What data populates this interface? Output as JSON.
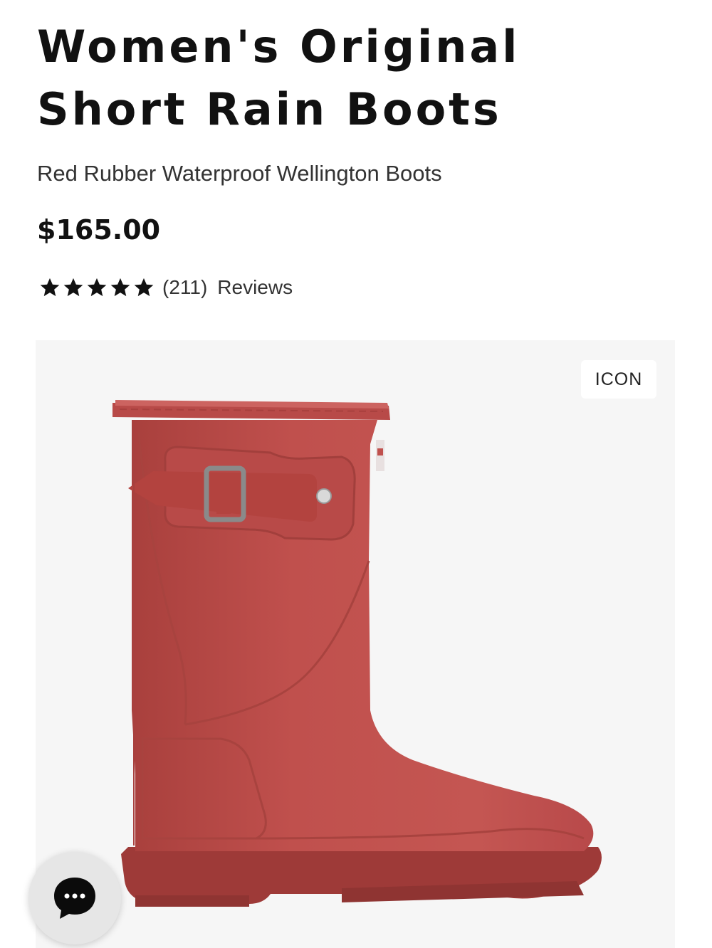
{
  "product": {
    "title": "Women's Original Short Rain Boots",
    "subtitle": "Red Rubber Waterproof Wellington Boots",
    "price": "$165.00",
    "rating": {
      "stars": 5,
      "max_stars": 5,
      "count": "(211)",
      "reviews_label": "Reviews"
    },
    "badge": "ICON",
    "image": {
      "icon": "red-rain-boot-image",
      "boot_color": "#c0504d"
    }
  },
  "chat": {
    "icon": "chat-bubble-icon"
  },
  "colors": {
    "text": "#111111",
    "image_background": "#f6f6f6",
    "boot": "#c0504d"
  }
}
